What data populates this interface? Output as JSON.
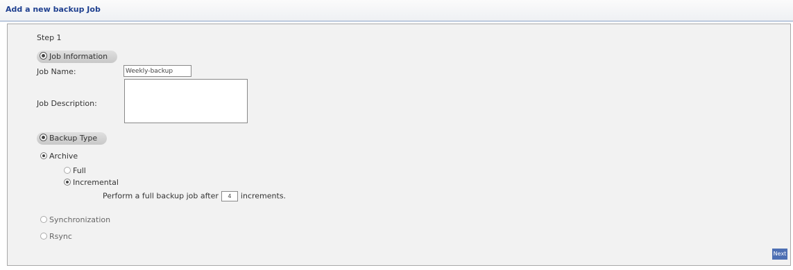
{
  "window": {
    "title": "Add a new backup Job"
  },
  "step": {
    "label": "Step 1"
  },
  "job_info": {
    "section_label": "Job Information",
    "name_label": "Job Name:",
    "name_value": "Weekly-backup",
    "description_label": "Job Description:",
    "description_value": ""
  },
  "backup_type": {
    "section_label": "Backup Type",
    "archive_label": "Archive",
    "archive_checked": true,
    "full_label": "Full",
    "full_checked": false,
    "incremental_label": "Incremental",
    "incremental_checked": true,
    "perform_prefix": "Perform a full backup job after",
    "increments_value": "4",
    "perform_suffix": "increments.",
    "synchronization_label": "Synchronization",
    "synchronization_checked": false,
    "rsync_label": "Rsync",
    "rsync_checked": false
  },
  "buttons": {
    "next_label": "Next"
  }
}
